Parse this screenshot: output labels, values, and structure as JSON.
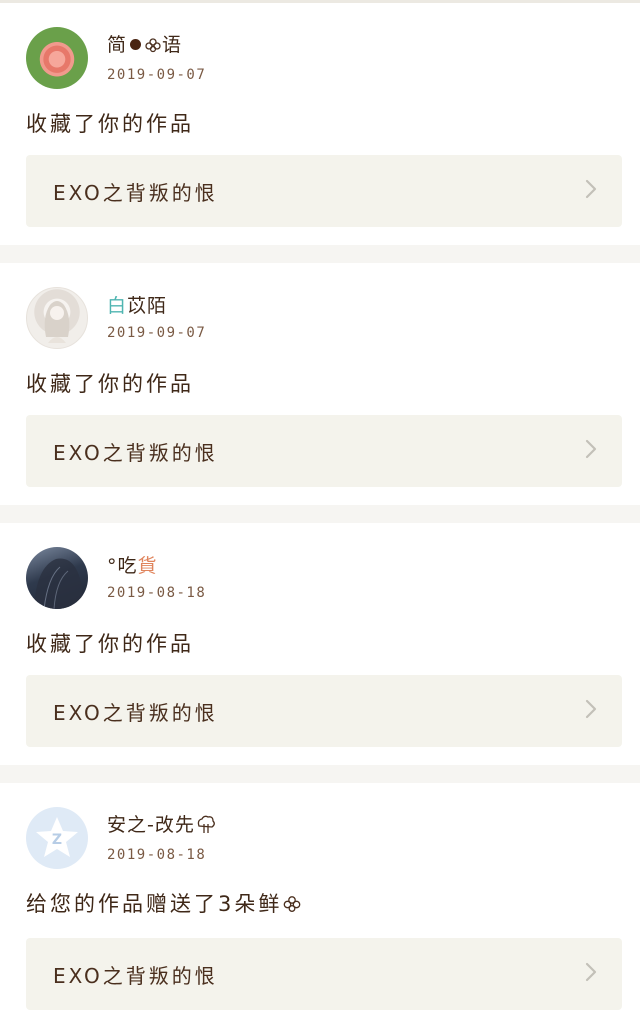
{
  "feed": [
    {
      "user": {
        "name_parts": [
          "简",
          "",
          "语"
        ],
        "avatar_icon": "rose-avatar"
      },
      "date": "2019-09-07",
      "action": "收藏了你的作品",
      "work": "EXO之背叛的恨"
    },
    {
      "user": {
        "name_parts": [
          "白",
          "苡陌"
        ],
        "avatar_icon": "anime-girl-avatar"
      },
      "date": "2019-09-07",
      "action": "收藏了你的作品",
      "work": "EXO之背叛的恨"
    },
    {
      "user": {
        "name_parts": [
          "°吃",
          "貨"
        ],
        "avatar_icon": "hair-avatar"
      },
      "date": "2019-08-18",
      "action": "收藏了你的作品",
      "work": "EXO之背叛的恨"
    },
    {
      "user": {
        "name_parts": [
          "安之-改先"
        ],
        "avatar_icon": "qq-default-avatar"
      },
      "date": "2019-08-18",
      "action": "给您的作品赠送了3朵鲜",
      "work": "EXO之背叛的恨"
    }
  ],
  "colors": {
    "background": "#f6f5f2",
    "card": "#ffffff",
    "link_background": "#f4f3ec",
    "text": "#3f2818",
    "date": "#7a5a44"
  }
}
